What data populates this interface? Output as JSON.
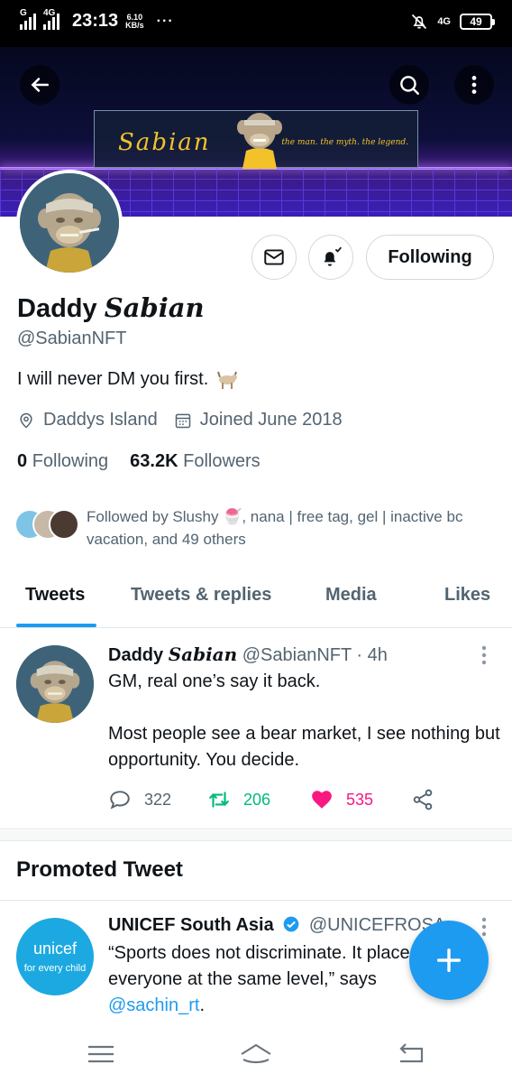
{
  "status_bar": {
    "signal1_label": "G",
    "signal2_label": "4G",
    "time": "23:13",
    "speed_value": "6.10",
    "speed_unit": "KB/s",
    "more": "···",
    "network": "4G",
    "battery": "49"
  },
  "banner": {
    "name": "Sabian",
    "tagline": "the man. the myth. the legend."
  },
  "profile": {
    "display_name_plain": "Daddy ",
    "display_name_styled": "Sabian",
    "handle": "@SabianNFT",
    "bio": "I will never DM you first.",
    "location": "Daddys Island",
    "joined": "Joined June 2018",
    "following_count": "0",
    "following_label": "Following",
    "followers_count": "63.2K",
    "followers_label": "Followers",
    "followed_by": "Followed by Slushy 🍧, nana | free tag, gel | inactive bc vacation, and 49 others",
    "following_button": "Following"
  },
  "tabs": [
    "Tweets",
    "Tweets & replies",
    "Media",
    "Likes"
  ],
  "tweet": {
    "name_plain": "Daddy ",
    "name_styled": "Sabian",
    "handle_time": "@SabianNFT · 4h",
    "line1": "GM, real one’s say it back.",
    "line2": "Most people see a bear market, I see nothing but opportunity. You decide.",
    "replies": "322",
    "retweets": "206",
    "likes": "535"
  },
  "promoted": {
    "section_title": "Promoted Tweet",
    "avatar_line1": "unicef",
    "avatar_line2": "for every child",
    "name": "UNICEF South Asia",
    "handle": "@UNICEFROSA",
    "body": "“Sports does not discriminate. It places everyone at the same level,” says",
    "mention": "@sachin_rt",
    "tail": "."
  },
  "colors": {
    "accent": "#1d9bf0",
    "retweet": "#00ba7c",
    "like": "#f91880",
    "muted": "#536471"
  }
}
